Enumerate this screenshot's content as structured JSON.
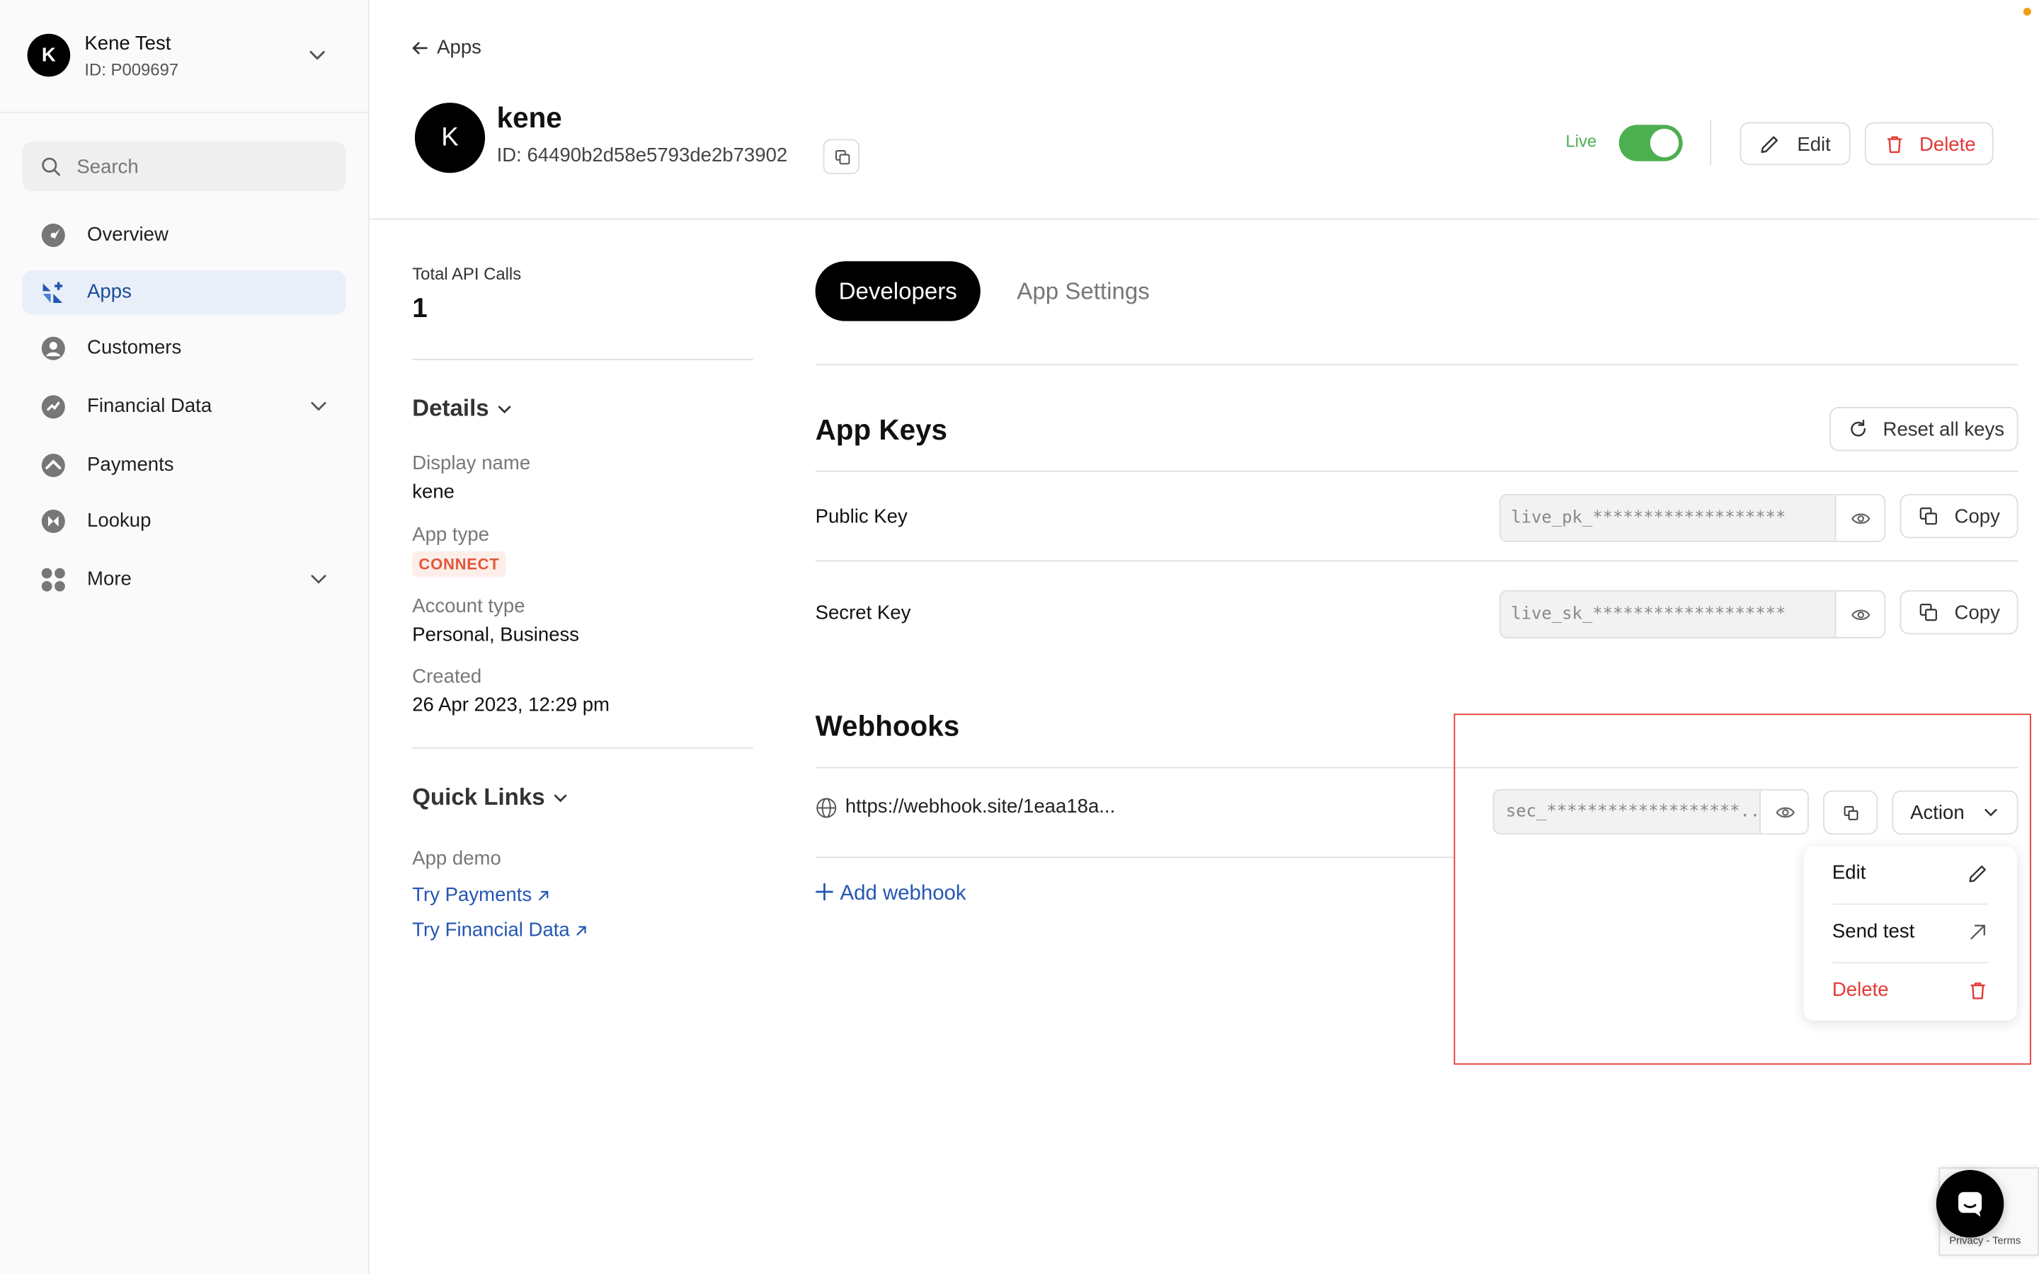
{
  "org": {
    "avatar_initial": "K",
    "name": "Kene Test",
    "id": "ID: P009697"
  },
  "sidebar": {
    "search_placeholder": "Search",
    "items": [
      {
        "label": "Overview",
        "icon": "overview-icon"
      },
      {
        "label": "Apps",
        "icon": "apps-icon",
        "active": true
      },
      {
        "label": "Customers",
        "icon": "customers-icon"
      },
      {
        "label": "Financial Data",
        "icon": "financial-data-icon",
        "has_submenu": true
      },
      {
        "label": "Payments",
        "icon": "payments-icon"
      },
      {
        "label": "Lookup",
        "icon": "lookup-icon"
      },
      {
        "label": "More",
        "icon": "more-icon",
        "has_submenu": true
      }
    ]
  },
  "header": {
    "back_label": "Apps",
    "avatar_initial": "K",
    "app_name": "kene",
    "app_id": "ID: 64490b2d58e5793de2b73902",
    "live_label": "Live",
    "live_on": true,
    "edit_label": "Edit",
    "delete_label": "Delete"
  },
  "stats": {
    "total_api_calls_label": "Total API Calls",
    "total_api_calls_value": "1"
  },
  "details": {
    "heading": "Details",
    "display_name_label": "Display name",
    "display_name_value": "kene",
    "app_type_label": "App type",
    "app_type_value": "CONNECT",
    "account_type_label": "Account type",
    "account_type_value": "Personal, Business",
    "created_label": "Created",
    "created_value": "26 Apr 2023, 12:29 pm"
  },
  "quick_links": {
    "heading": "Quick Links",
    "app_demo_label": "App demo",
    "links": [
      "Try Payments",
      "Try Financial Data"
    ]
  },
  "tabs": [
    {
      "label": "Developers",
      "active": true
    },
    {
      "label": "App Settings",
      "active": false
    }
  ],
  "app_keys": {
    "heading": "App Keys",
    "reset_label": "Reset all keys",
    "public_key_label": "Public Key",
    "public_key_value": "live_pk_*******************",
    "secret_key_label": "Secret Key",
    "secret_key_value": "live_sk_*******************",
    "copy_label": "Copy"
  },
  "webhooks": {
    "heading": "Webhooks",
    "url": "https://webhook.site/1eaa18a...",
    "secret": "sec_*******************...",
    "action_label": "Action",
    "add_label": "Add webhook",
    "menu": [
      {
        "label": "Edit",
        "icon": "pencil-icon"
      },
      {
        "label": "Send test",
        "icon": "arrow-up-right-icon"
      },
      {
        "label": "Delete",
        "icon": "trash-icon",
        "danger": true
      }
    ]
  },
  "footer": {
    "recaptcha_text": "Privacy - Terms"
  },
  "colors": {
    "accent_blue": "#2456b3",
    "live_green": "#4caf50",
    "danger_red": "#e53935",
    "pill_orange": "#e0583a"
  }
}
